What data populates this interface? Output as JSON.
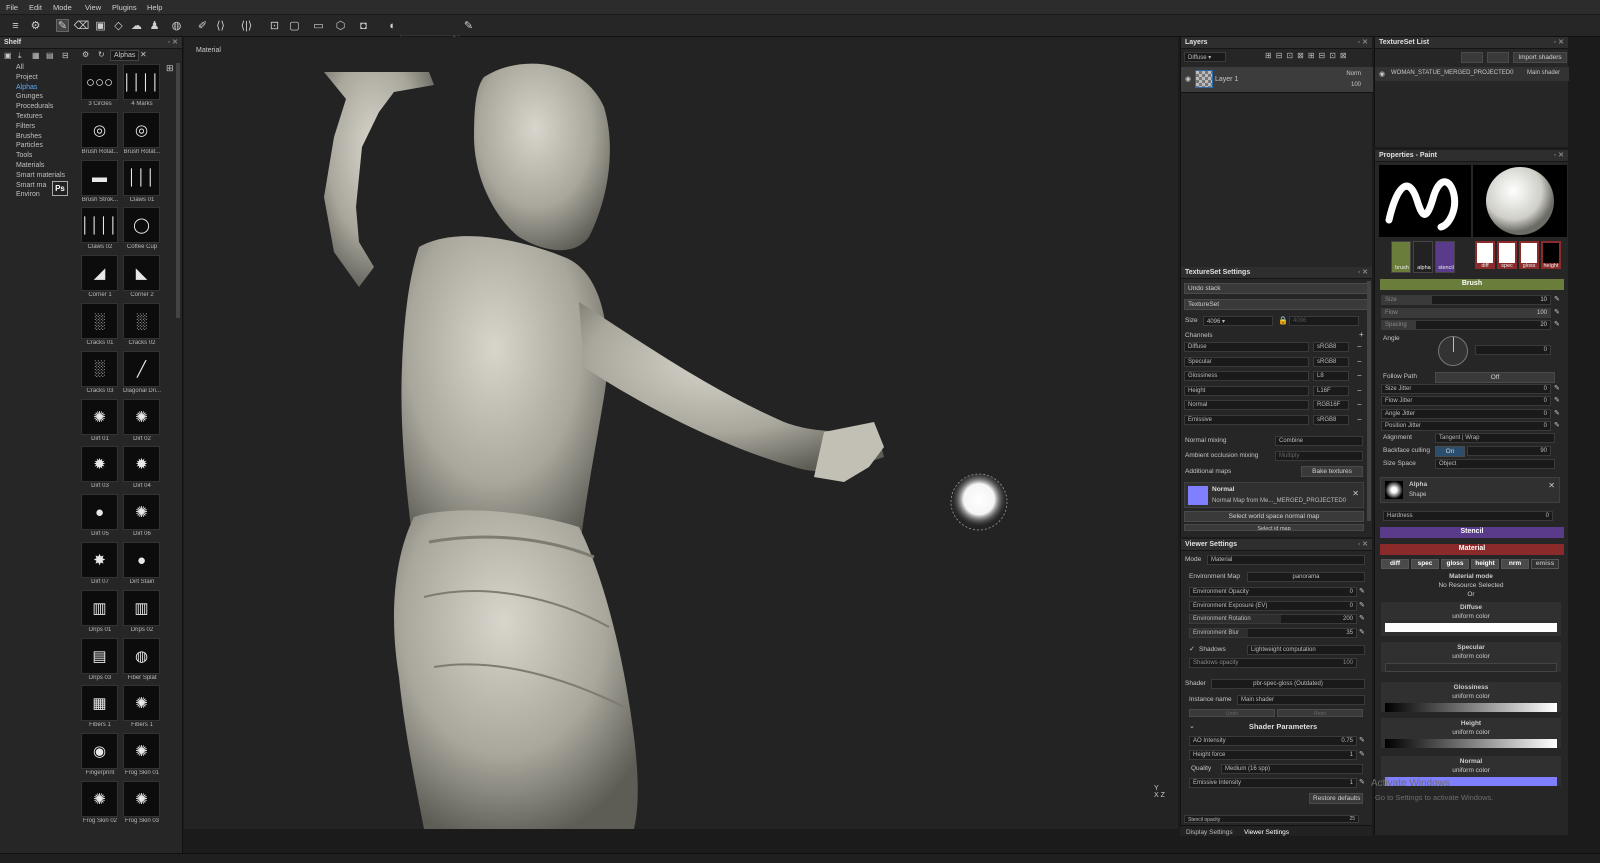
{
  "menu": [
    "File",
    "Edit",
    "Mode",
    "View",
    "Plugins",
    "Help"
  ],
  "toolbar": {
    "brush_size_value": "8"
  },
  "shelf": {
    "title": "Shelf",
    "tab_label": "Alphas",
    "categories": [
      "All",
      "Project",
      "Alphas",
      "Grunges",
      "Procedurals",
      "Textures",
      "Filters",
      "Brushes",
      "Particles",
      "Tools",
      "Materials",
      "Smart materials",
      "Smart ma",
      "Environ"
    ],
    "selected_category": "Alphas",
    "ps_badge": "Ps",
    "items": [
      "3 Circles",
      "4 Marks",
      "Brush Rotat...",
      "Brush Rotat...",
      "Brush Strok...",
      "Claws 01",
      "Claws 02",
      "Coffee Cup",
      "Corner 1",
      "Corner 2",
      "Cracks 01",
      "Cracks 02",
      "Cracks 03",
      "Diagonal Dri...",
      "Dirt 01",
      "Dirt 02",
      "Dirt 03",
      "Dirt 04",
      "Dirt 05",
      "Dirt 06",
      "Dirt 07",
      "Dirt Stain",
      "Drips 01",
      "Drips 02",
      "Drips 03",
      "Fiber Splat",
      "Fibers 1",
      "Fibers 1",
      "Fingerprint",
      "Frog Skin 01",
      "Frog Skin 02",
      "Frog Skin 03"
    ]
  },
  "viewport": {
    "label": "Material",
    "axis_y": "Y",
    "axis_xz": "X Z"
  },
  "layers": {
    "title": "Layers",
    "channel": "Diffuse",
    "layer_name": "Layer 1",
    "blend": "Norm",
    "opacity": "100"
  },
  "textureset_settings": {
    "title": "TextureSet Settings",
    "undo": "Undo stack",
    "textureset": "TextureSet",
    "size_label": "Size",
    "size_value": "4096",
    "size_value2": "4096",
    "channels_label": "Channels",
    "channels": [
      {
        "name": "Diffuse",
        "format": "sRGB8"
      },
      {
        "name": "Specular",
        "format": "sRGB8"
      },
      {
        "name": "Glossiness",
        "format": "L8"
      },
      {
        "name": "Height",
        "format": "L16F"
      },
      {
        "name": "Normal",
        "format": "RGB16F"
      },
      {
        "name": "Emissive",
        "format": "sRGB8"
      }
    ],
    "normal_mixing_label": "Normal mixing",
    "normal_mixing_value": "Combine",
    "ao_mixing_label": "Ambient occlusion mixing",
    "ao_mixing_value": "Multiply",
    "additional_maps_label": "Additional maps",
    "bake_button": "Bake textures",
    "normal_title": "Normal",
    "normal_desc": "Normal Map from Me..._MERGED_PROJECTED0",
    "select_ws_normal": "Select world space normal map",
    "select_id": "Select id map"
  },
  "viewer_settings": {
    "title": "Viewer Settings",
    "mode_label": "Mode",
    "mode_value": "Material",
    "env_map_label": "Environment Map",
    "env_map_value": "panorama",
    "sliders": [
      {
        "label": "Environment Opacity",
        "value": "0"
      },
      {
        "label": "Environment Exposure (EV)",
        "value": "0"
      },
      {
        "label": "Environment Rotation",
        "value": "200"
      },
      {
        "label": "Environment Blur",
        "value": "35"
      }
    ],
    "shadows_label": "Shadows",
    "shadows_value": "Lightweight computation",
    "shadows_opacity_label": "Shadows opacity",
    "shadows_opacity_value": "100",
    "shader_label": "Shader",
    "shader_value": "pbr-spec-gloss (Outdated)",
    "instance_label": "Instance name",
    "instance_value": "Main shader",
    "undo": "Undo",
    "redo": "Redo",
    "shader_params": "Shader Parameters",
    "params": [
      {
        "label": "AO Intensity",
        "value": "0.75"
      },
      {
        "label": "Height force",
        "value": "1"
      },
      {
        "label": "Quality",
        "value": "Medium (16 spp)"
      },
      {
        "label": "Emissive Intensity",
        "value": "1"
      }
    ],
    "restore_defaults": "Restore defaults",
    "stencil_opacity": "Stencil opacity",
    "stencil_opacity_value": "25"
  },
  "bottom_tabs": [
    "Display Settings",
    "Viewer Settings"
  ],
  "textureset_list": {
    "title": "TextureSet List",
    "import_shaders": "Import shaders",
    "item_name": "WOMAN_STATUE_MERGED_PROJECTED0",
    "item_shader": "Main shader"
  },
  "properties": {
    "title": "Properties - Paint",
    "tool_slots": [
      "brush",
      "alpha",
      "stencil"
    ],
    "material_slots": [
      "diff",
      "spec",
      "gloss",
      "height"
    ],
    "brush_section": "Brush",
    "brush_params": [
      {
        "label": "Size",
        "value": "10"
      },
      {
        "label": "Flow",
        "value": "100"
      },
      {
        "label": "Spacing",
        "value": "20"
      }
    ],
    "angle_label": "Angle",
    "angle_value": "0",
    "follow_path_label": "Follow Path",
    "follow_path_value": "Off",
    "jitters": [
      {
        "label": "Size Jitter",
        "value": "0"
      },
      {
        "label": "Flow Jitter",
        "value": "0"
      },
      {
        "label": "Angle Jitter",
        "value": "0"
      },
      {
        "label": "Position Jitter",
        "value": "0"
      }
    ],
    "alignment_label": "Alignment",
    "alignment_value": "Tangent | Wrap",
    "backface_label": "Backface culling",
    "backface_toggle": "On",
    "backface_value": "90",
    "size_space_label": "Size Space",
    "size_space_value": "Object",
    "alpha_title": "Alpha",
    "alpha_sub": "Shape",
    "hardness_label": "Hardness",
    "hardness_value": "0",
    "stencil_section": "Stencil",
    "material_section": "Material",
    "mat_toggles": [
      "diff",
      "spec",
      "gloss",
      "height",
      "nrm",
      "emiss"
    ],
    "material_mode": "Material mode",
    "no_resource": "No Resource Selected",
    "or": "Or",
    "channels": [
      {
        "name": "Diffuse",
        "sub": "uniform color"
      },
      {
        "name": "Specular",
        "sub": "uniform color"
      },
      {
        "name": "Glossiness",
        "sub": "uniform color"
      },
      {
        "name": "Height",
        "sub": "uniform color"
      },
      {
        "name": "Normal",
        "sub": "uniform color"
      }
    ],
    "watermark1": "Activate Windows",
    "watermark2": "Go to Settings to activate Windows.",
    "colors": {
      "brush_green": "#6b7d3a",
      "stencil_purple": "#5a3a8a",
      "material_red": "#8a2a2a",
      "normal_blue": "#7f7fff"
    }
  }
}
